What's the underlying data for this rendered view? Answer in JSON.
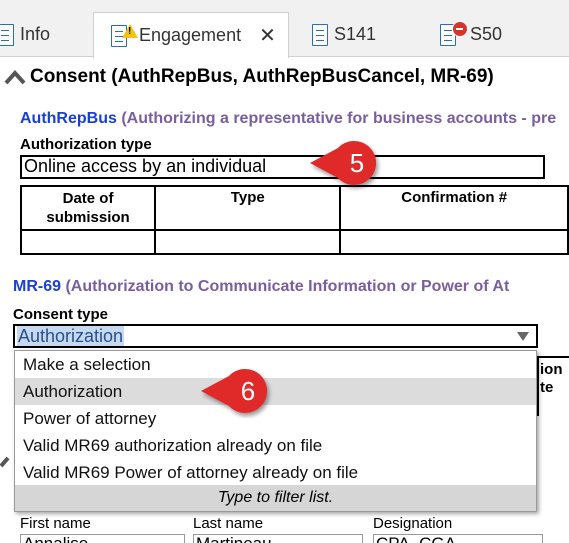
{
  "tabs": [
    {
      "label": "Info"
    },
    {
      "label": "Engagement",
      "close": "✕"
    },
    {
      "label": "S141"
    },
    {
      "label": "S50"
    }
  ],
  "section": {
    "title": "Consent (AuthRepBus, AuthRepBusCancel, MR-69)"
  },
  "authrepbus": {
    "code": "AuthRepBus",
    "desc": "(Authorizing a representative for business accounts - pre",
    "auth_type_label": "Authorization type",
    "auth_type_value": "Online access by an individual",
    "columns": [
      "Date of submission",
      "Type",
      "Confirmation #"
    ],
    "col_date_1": "Date of",
    "col_date_2": "submission"
  },
  "mr69": {
    "code": "MR-69",
    "desc": "(Authorization to Communicate Information or Power of At",
    "consent_type_label": "Consent type",
    "consent_type_value": "Authorization",
    "options": [
      "Make a selection",
      "Authorization",
      "Power of attorney",
      "Valid MR69 authorization already on file",
      "Valid MR69 Power of attorney already on file"
    ],
    "filter_hint": "Type to filter list.",
    "behind_text_1": "ion",
    "behind_text_2": "te"
  },
  "callouts": [
    {
      "number": "5"
    },
    {
      "number": "6"
    }
  ],
  "contact": {
    "first_name_label": "First name",
    "first_name_value": "Annalise",
    "last_name_label": "Last name",
    "last_name_value": "Martineau",
    "designation_label": "Designation",
    "designation_value": "CPA, CGA"
  },
  "colors": {
    "link_blue": "#1a3fd6",
    "desc_purple": "#7a5fa0",
    "callout_red": "#e0292b",
    "selection_bg": "#c5d9f1"
  }
}
